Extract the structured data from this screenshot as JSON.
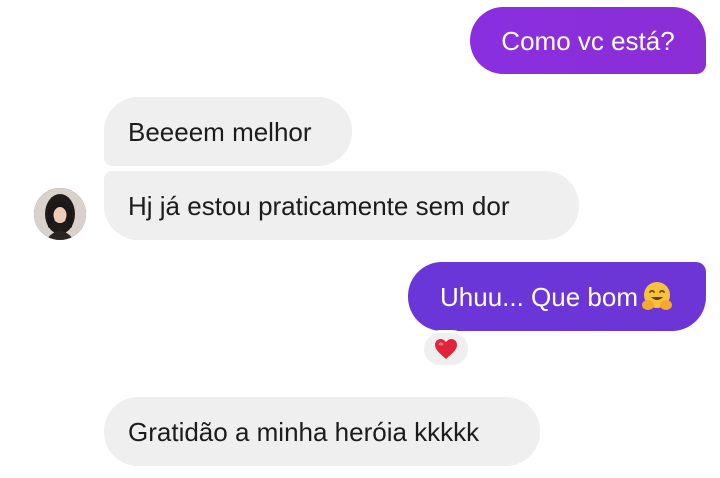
{
  "messages": {
    "out_1": "Como vc está?",
    "in_1": "Beeeem melhor",
    "in_2": "Hj já estou praticamente sem dor",
    "out_2": "Uhuu... Que bom",
    "in_3": "Gratidão a minha heróia kkkkk"
  },
  "icons": {
    "hug_emoji": "hugging-face-emoji",
    "reaction": "red-heart-emoji",
    "avatar": "contact-avatar"
  },
  "colors": {
    "outgoing_1": "#8a2fe0",
    "outgoing_2": "#6a36d8",
    "incoming": "#efefef",
    "heart": "#e0243a"
  }
}
